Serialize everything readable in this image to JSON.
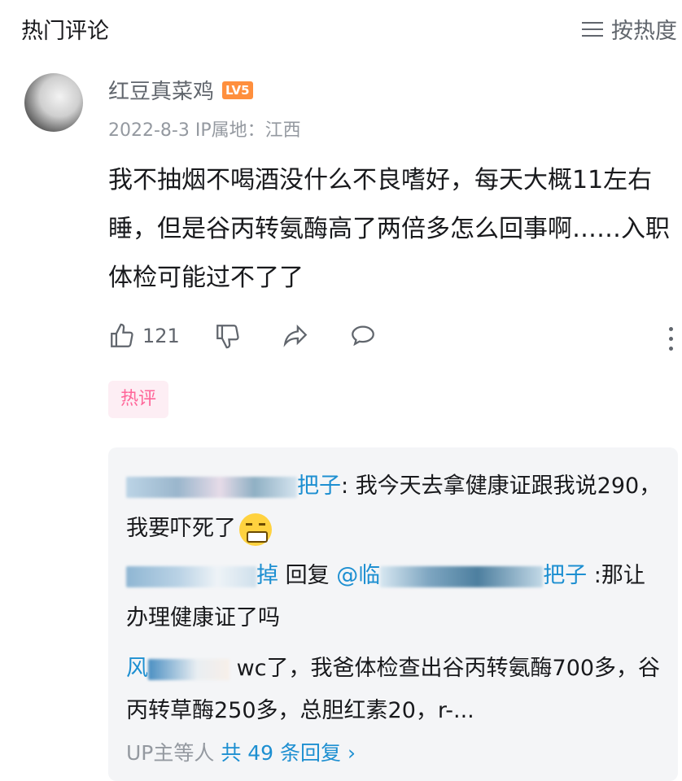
{
  "header": {
    "title": "热门评论",
    "sort_label": "按热度"
  },
  "comment": {
    "username": "红豆真菜鸡",
    "level": "LV5",
    "date": "2022-8-3",
    "ip_location": "IP属地：江西",
    "content": "我不抽烟不喝酒没什么不良嗜好，每天大概11左右睡，但是谷丙转氨酶高了两倍多怎么回事啊……入职体检可能过不了了",
    "like_count": "121",
    "hot_tag": "热评"
  },
  "replies": [
    {
      "user_suffix": "把子",
      "text": "我今天去拿健康证跟我说290，我要吓死了"
    },
    {
      "user_suffix": "掉",
      "reply_word": "回复",
      "mention_prefix": "@临",
      "mention_suffix": "把子",
      "text": ":那让办理健康证了吗"
    },
    {
      "user_prefix": "风",
      "text": "wc了，我爸体检查出谷丙转氨酶700多，谷丙转草酶250多，总胆红素20，r-..."
    }
  ],
  "replies_footer": {
    "prefix": "UP主等人",
    "count_text": "共 49 条回复"
  },
  "colors": {
    "link": "#1d8fd1",
    "hot_tag": "#ff6699",
    "level_badge": "#ff8f3d"
  }
}
